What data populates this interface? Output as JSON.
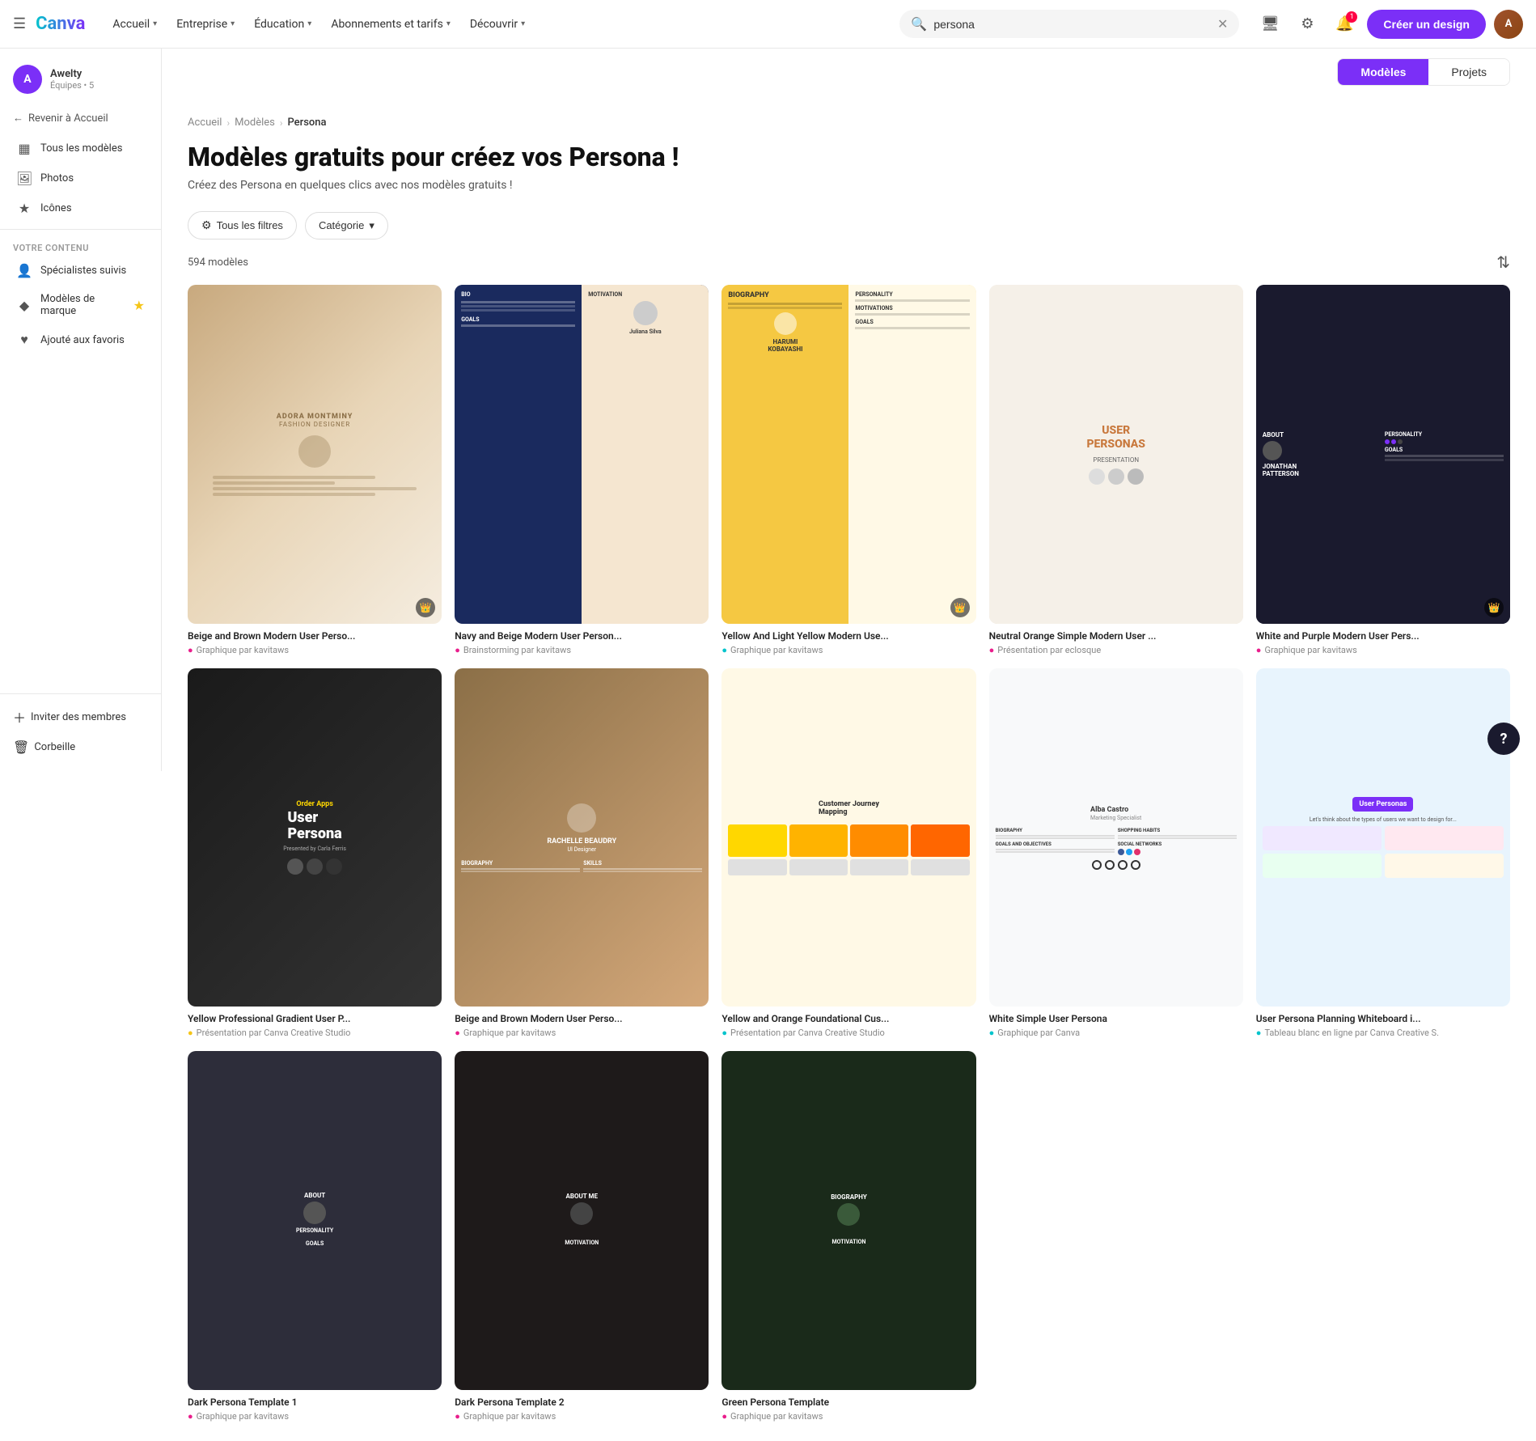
{
  "topnav": {
    "hamburger": "☰",
    "logo": "Canva",
    "links": [
      {
        "label": "Accueil",
        "id": "accueil"
      },
      {
        "label": "Entreprise",
        "id": "entreprise"
      },
      {
        "label": "Éducation",
        "id": "education"
      },
      {
        "label": "Abonnements et tarifs",
        "id": "abonnements"
      },
      {
        "label": "Découvrir",
        "id": "decouvrir"
      }
    ],
    "search_placeholder": "persona",
    "search_value": "persona",
    "create_label": "Créer un design",
    "notification_count": "1"
  },
  "sidebar": {
    "user": {
      "initial": "A",
      "name": "Awelty",
      "team": "Équipes • 5"
    },
    "back_label": "Revenir à Accueil",
    "items": [
      {
        "id": "tous-modeles",
        "label": "Tous les modèles",
        "icon": "▦"
      },
      {
        "id": "photos",
        "label": "Photos",
        "icon": "🖼"
      },
      {
        "id": "icones",
        "label": "Icônes",
        "icon": "★"
      }
    ],
    "section_label": "Votre contenu",
    "content_items": [
      {
        "id": "specialistes",
        "label": "Spécialistes suivis",
        "icon": "👤"
      },
      {
        "id": "modeles-marque",
        "label": "Modèles de marque",
        "icon": "◆",
        "has_star": true
      },
      {
        "id": "favoris",
        "label": "Ajouté aux favoris",
        "icon": "♥"
      }
    ],
    "bottom_items": [
      {
        "id": "inviter",
        "label": "Inviter des membres",
        "icon": "+"
      },
      {
        "id": "corbeille",
        "label": "Corbeille",
        "icon": "🗑"
      }
    ]
  },
  "tabs": {
    "modeles": "Modèles",
    "projets": "Projets"
  },
  "breadcrumb": {
    "home": "Accueil",
    "templates": "Modèles",
    "current": "Persona"
  },
  "page": {
    "title": "Modèles gratuits pour créez vos Persona !",
    "subtitle": "Créez des Persona en quelques clics avec nos modèles gratuits !",
    "count": "594 modèles",
    "filter_all": "Tous les filtres",
    "filter_category": "Catégorie"
  },
  "templates": [
    {
      "id": "t1",
      "name": "Beige and Brown Modern User Perso...",
      "type": "Graphique par kavitaws",
      "bg": "thumb-beige-brown",
      "pro": true,
      "meta_color": "meta-icon-pink",
      "row": 1
    },
    {
      "id": "t2",
      "name": "Navy and Beige Modern User Person...",
      "type": "Brainstorming par kavitaws",
      "bg": "thumb-navy-beige",
      "pro": false,
      "meta_color": "meta-icon-pink",
      "row": 1
    },
    {
      "id": "t3",
      "name": "Yellow And Light Yellow Modern Use...",
      "type": "Graphique par kavitaws",
      "bg": "thumb-yellow-light",
      "pro": true,
      "meta_color": "meta-icon-cyan",
      "row": 1
    },
    {
      "id": "t4",
      "name": "Neutral Orange Simple Modern User ...",
      "type": "Présentation par eclosque",
      "bg": "thumb-neutral-orange",
      "pro": false,
      "meta_color": "meta-icon-pink",
      "row": 1
    },
    {
      "id": "t5",
      "name": "White and Purple Modern User Pers...",
      "type": "Graphique par kavitaws",
      "bg": "thumb-white-purple",
      "pro": true,
      "meta_color": "meta-icon-pink",
      "row": 1
    },
    {
      "id": "t6",
      "name": "Yellow Professional Gradient User P...",
      "type": "Présentation par Canva Creative Studio",
      "bg": "thumb-yellow-pro",
      "pro": false,
      "meta_color": "meta-icon-yellow",
      "row": 2
    },
    {
      "id": "t7",
      "name": "Beige and Brown Modern User Perso...",
      "type": "Graphique par kavitaws",
      "bg": "thumb-beige-brown2",
      "pro": false,
      "meta_color": "meta-icon-pink",
      "row": 2
    },
    {
      "id": "t8",
      "name": "Yellow and Orange Foundational Cus...",
      "type": "Présentation par Canva Creative Studio",
      "bg": "thumb-yellow-orange",
      "pro": false,
      "meta_color": "meta-icon-cyan",
      "row": 2
    },
    {
      "id": "t9",
      "name": "White Simple User Persona",
      "type": "Graphique par Canva",
      "bg": "thumb-white-simple",
      "pro": false,
      "meta_color": "meta-icon-cyan",
      "row": 2
    },
    {
      "id": "t10",
      "name": "User Persona Planning Whiteboard i...",
      "type": "Tableau blanc en ligne par Canva Creative S.",
      "bg": "thumb-user-persona",
      "pro": false,
      "meta_color": "meta-icon-cyan",
      "row": 2
    },
    {
      "id": "t11",
      "name": "Dark Persona Template 1",
      "type": "Graphique par kavitaws",
      "bg": "thumb-dark1",
      "pro": false,
      "meta_color": "meta-icon-pink",
      "row": 3
    },
    {
      "id": "t12",
      "name": "Dark Persona Template 2",
      "type": "Graphique par kavitaws",
      "bg": "thumb-dark2",
      "pro": false,
      "meta_color": "meta-icon-pink",
      "row": 3
    },
    {
      "id": "t13",
      "name": "Green Persona Template",
      "type": "Graphique par kavitaws",
      "bg": "thumb-dark3",
      "pro": false,
      "meta_color": "meta-icon-pink",
      "row": 3
    }
  ]
}
